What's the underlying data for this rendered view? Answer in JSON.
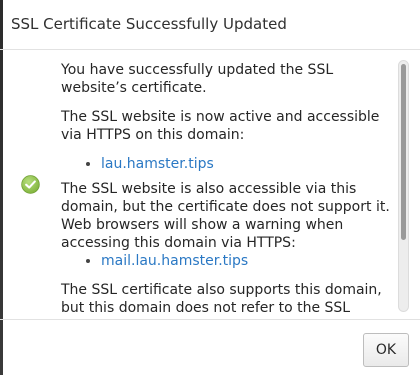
{
  "dialog": {
    "title": "SSL Certificate Successfully Updated",
    "paragraph1": "You have successfully updated the SSL website’s certificate.",
    "paragraph2": "The SSL website is now active and accessible via HTTPS on this domain:",
    "domain1": "lau.hamster.tips",
    "paragraph3": "The SSL website is also accessible via this domain, but the certificate does not support it. Web browsers will show a warning when accessing this domain via HTTPS:",
    "domain2": "mail.lau.hamster.tips",
    "paragraph4": "The SSL certificate also supports this domain, but this domain does not refer to the SSL website.",
    "icon": "check-circle-icon",
    "ok_label": "OK"
  },
  "colors": {
    "link": "#2a78c4",
    "success_icon": "#8dc63f"
  }
}
